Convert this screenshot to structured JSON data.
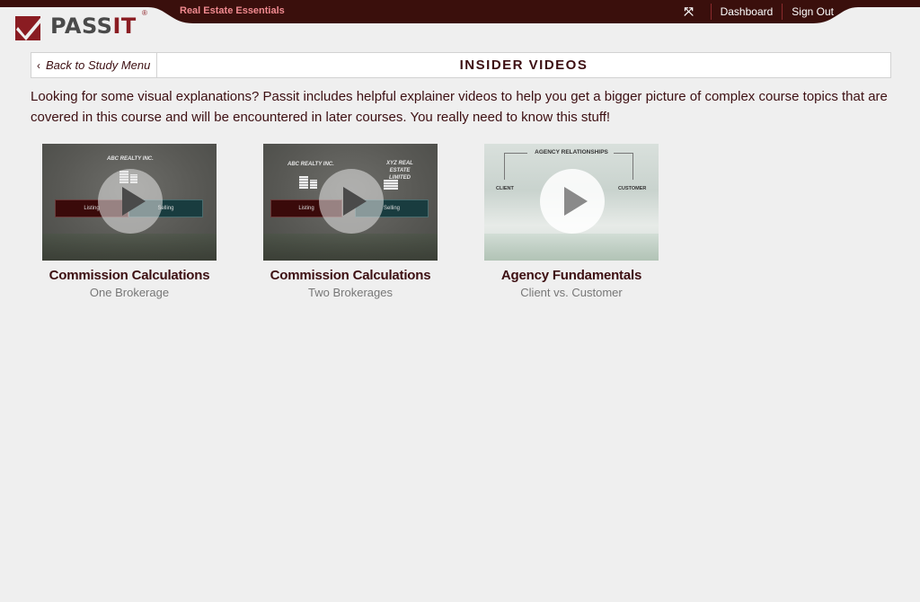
{
  "app": {
    "logo_text": "PASS",
    "logo_text_accent": "IT",
    "logo_registered": "®",
    "course_title": "Real Estate Essentials"
  },
  "nav": {
    "fullscreen_icon": "fullscreen-icon",
    "dashboard_label": "Dashboard",
    "signout_label": "Sign Out"
  },
  "colors": {
    "topbar": "#3a0f0c",
    "brand_maroon": "#8a1c22",
    "course_title": "#f08a90",
    "text": "#3d0f12",
    "background": "#efefef"
  },
  "header": {
    "back_chevron": "‹",
    "back_label": "Back to Study Menu",
    "title": "INSIDER VIDEOS"
  },
  "intro_text": "Looking for some visual explanations? Passit includes helpful explainer videos to help you get a bigger picture of complex course topics that are covered in this course and will be encountered in later courses. You really need to know this stuff!",
  "videos": [
    {
      "title": "Commission Calculations",
      "subtitle": "One Brokerage",
      "thumb": {
        "company": "ABC REALTY INC.",
        "listing": "Listing",
        "selling": "Selling"
      }
    },
    {
      "title": "Commission Calculations",
      "subtitle": "Two Brokerages",
      "thumb": {
        "company_a": "ABC REALTY INC.",
        "company_b": "XYZ REAL ESTATE LIMITED",
        "listing": "Listing",
        "selling": "Selling"
      }
    },
    {
      "title": "Agency Fundamentals",
      "subtitle": "Client vs. Customer",
      "thumb": {
        "heading": "AGENCY RELATIONSHIPS",
        "left": "CLIENT",
        "right": "CUSTOMER"
      }
    }
  ]
}
